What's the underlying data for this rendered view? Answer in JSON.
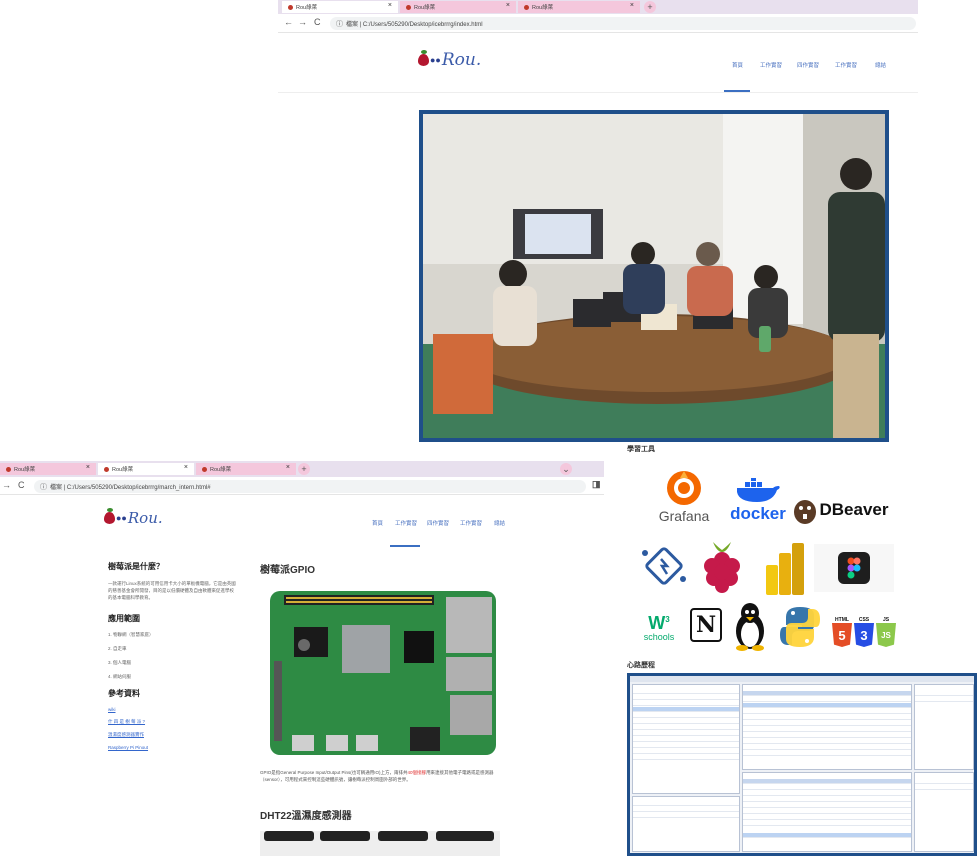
{
  "window1": {
    "tabs": [
      {
        "label": "Rou綠萊"
      },
      {
        "label": "Rou綠萊"
      },
      {
        "label": "Rou綠萊"
      }
    ],
    "nav": {
      "back": "←",
      "forward": "→",
      "reload": "C"
    },
    "url": "檔案 | C:/Users/505290/Desktop/icebrrrg/index.html",
    "brand": "Rou.",
    "menu": [
      "首頁",
      "工作實習",
      "四作實習",
      "工作實習",
      "總結"
    ]
  },
  "window2": {
    "tabs": [
      {
        "label": "Rou綠萊"
      },
      {
        "label": "Rou綠萊"
      },
      {
        "label": "Rou綠萊"
      }
    ],
    "url": "檔案 | C:/Users/505290/Desktop/icebrrrg/march_intern.html#",
    "brand": "Rou.",
    "menu": [
      "首頁",
      "工作實習",
      "四作實習",
      "工作實習",
      "總結"
    ],
    "left": {
      "what_title": "樹莓派是什麼？",
      "what_text": "一款運行Linux系統的可用信用卡大小的單板機電腦，它是由英國的慈善基金會所開發，目的是以低價硬體及自由軟體來促進學校的基本電腦科學教育。",
      "apps_title": "應用範圍",
      "apps": [
        "1. 物聯網（智慧家庭）",
        "2. 自走車",
        "3. 個人電腦",
        "4. 網站伺服"
      ],
      "refs_title": "參考資料",
      "refs": [
        "wiki",
        "什 四 是 樹 莓 派 ?",
        "溫濕度感測器實作",
        "Raspberry Pi Pinout"
      ]
    },
    "right": {
      "gpio_title": "樹莓派GPIO",
      "gpio_text_a": "GPIO是指General Purpose Input/Output Pins(也可稱通用IO)上方，兩排共",
      "gpio_text_hl": "40個接腳",
      "gpio_text_b": "用來連接其他電子電路或是感測器（sensor），可用程式來控制這些硬體訊號，讓樹莓派控制周圍外部的世界。",
      "dht_title": "DHT22溫濕度感測器"
    }
  },
  "tools": {
    "section_title": "學習工具",
    "grafana": "Grafana",
    "docker": "docker",
    "dbeaver": "DBeaver",
    "w3_top": "3",
    "w3_bottom": "schools",
    "notion": "N",
    "web_labels": [
      "HTML",
      "CSS",
      "JS"
    ],
    "web_numbers": [
      "5",
      "3",
      "JS"
    ]
  },
  "journey": {
    "section_title": "心路歷程"
  },
  "colors": {
    "frame_blue": "#1f4f8a",
    "link_blue": "#3366cc",
    "menu_blue": "#4a72c0",
    "tab_pink": "#f4c7dc",
    "grafana_orange": "#f46800",
    "docker_blue": "#1d63ed",
    "dbeaver_red": "#c0392b",
    "rpi_red": "#c51a4a",
    "powerbi_yellow": "#f2c811",
    "python_blue": "#3776ab",
    "python_yellow": "#ffd43b",
    "html_orange": "#e44d26",
    "css_blue": "#264de4",
    "js_green": "#8cc84b",
    "w3_green": "#04aa6d"
  }
}
